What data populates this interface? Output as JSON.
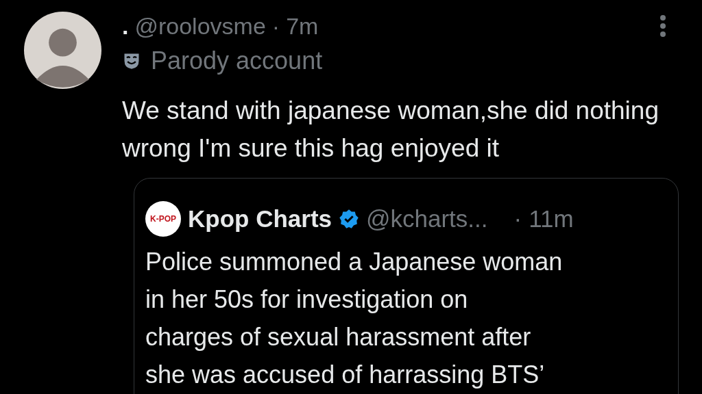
{
  "post": {
    "name": ".",
    "handle": "@roolovsme",
    "separator": "·",
    "time": "7m",
    "label": "Parody account",
    "text": "We stand with japanese woman,she did nothing wrong I'm sure this hag enjoyed it"
  },
  "quote": {
    "logo_text": "K-POP",
    "name": "Kpop Charts",
    "verified": true,
    "handle": "@kcharts...",
    "separator": "·",
    "time": "11m",
    "text_lines": [
      "Police summoned a Japanese woman",
      "in her 50s for investigation on",
      "charges of sexual harassment after",
      "she was accused of harrassing BTS’"
    ]
  }
}
